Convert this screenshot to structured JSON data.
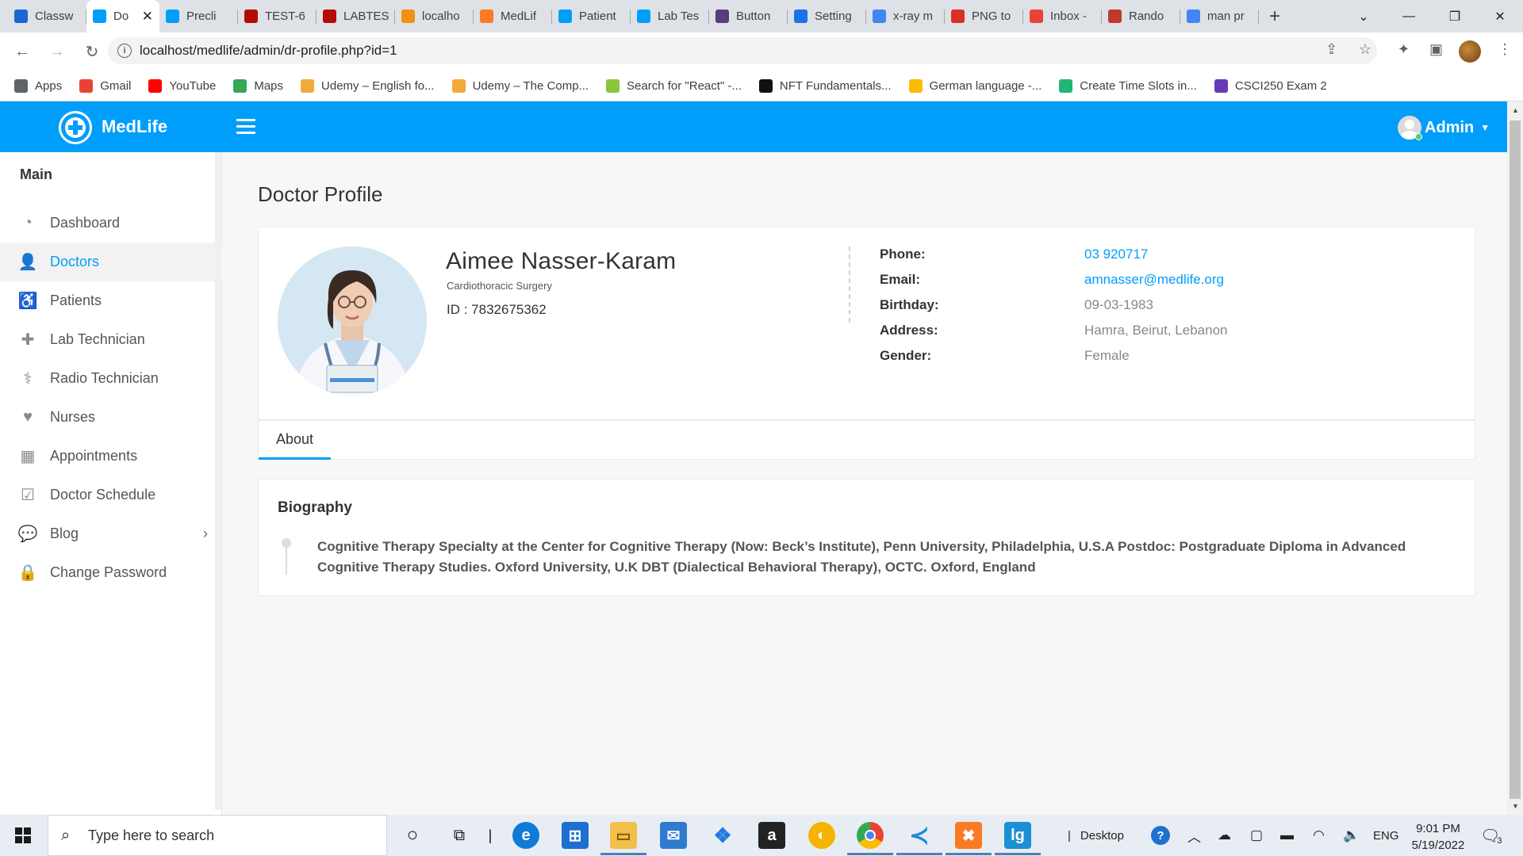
{
  "browser": {
    "tabs": [
      {
        "label": "Classw",
        "icon": "classroom-icon",
        "color": "#1967d2"
      },
      {
        "label": "Do",
        "icon": "medlife-icon",
        "color": "#009efb",
        "active": true
      },
      {
        "label": "Precli",
        "icon": "medlife-icon",
        "color": "#009efb"
      },
      {
        "label": "TEST-6",
        "icon": "pdf-icon",
        "color": "#b30b00"
      },
      {
        "label": "LABTES",
        "icon": "pdf-icon",
        "color": "#b30b00"
      },
      {
        "label": "localho",
        "icon": "phpmyadmin-icon",
        "color": "#f29111"
      },
      {
        "label": "MedLif",
        "icon": "xampp-icon",
        "color": "#fb7a24"
      },
      {
        "label": "Patient",
        "icon": "medlife-icon",
        "color": "#009efb"
      },
      {
        "label": "Lab Tes",
        "icon": "medlife-icon",
        "color": "#009efb"
      },
      {
        "label": "Button",
        "icon": "bootstrap-icon",
        "color": "#563d7c"
      },
      {
        "label": "Setting",
        "icon": "gear-icon",
        "color": "#1a73e8"
      },
      {
        "label": "x-ray m",
        "icon": "google-icon",
        "color": "#4285f4"
      },
      {
        "label": "PNG to",
        "icon": "pdf-icon",
        "color": "#d93025"
      },
      {
        "label": "Inbox -",
        "icon": "gmail-icon",
        "color": "#ea4335"
      },
      {
        "label": "Rando",
        "icon": "s-icon",
        "color": "#c0392b"
      },
      {
        "label": "man pr",
        "icon": "google-icon",
        "color": "#4285f4"
      }
    ],
    "close_glyph": "✕",
    "new_tab_glyph": "+",
    "url": "localhost/medlife/admin/dr-profile.php?id=1",
    "bookmarks": [
      {
        "label": "Apps",
        "icon": "apps-grid-icon",
        "color": "#5f6368"
      },
      {
        "label": "Gmail",
        "icon": "gmail-icon",
        "color": "#ea4335"
      },
      {
        "label": "YouTube",
        "icon": "youtube-icon",
        "color": "#ff0000"
      },
      {
        "label": "Maps",
        "icon": "maps-icon",
        "color": "#34a853"
      },
      {
        "label": "Udemy – English fo...",
        "icon": "udemy-icon",
        "color": "#f4a93c"
      },
      {
        "label": "Udemy – The Comp...",
        "icon": "udemy-icon",
        "color": "#f4a93c"
      },
      {
        "label": "Search for \"React\" -...",
        "icon": "upwork-icon",
        "color": "#8cc53f"
      },
      {
        "label": "NFT Fundamentals...",
        "icon": "nft-icon",
        "color": "#111111"
      },
      {
        "label": "German language -...",
        "icon": "drive-icon",
        "color": "#fbbc04"
      },
      {
        "label": "Create Time Slots in...",
        "icon": "dollar-icon",
        "color": "#22b573"
      },
      {
        "label": "CSCI250 Exam 2",
        "icon": "forms-icon",
        "color": "#673ab7"
      }
    ]
  },
  "app": {
    "brand": "MedLife",
    "user": "Admin",
    "sidebar": {
      "title": "Main",
      "items": [
        {
          "label": "Dashboard",
          "icon": "dashboard-icon",
          "glyph": "◔"
        },
        {
          "label": "Doctors",
          "icon": "doctor-icon",
          "glyph": "👤",
          "active": true
        },
        {
          "label": "Patients",
          "icon": "wheelchair-icon",
          "glyph": "♿"
        },
        {
          "label": "Lab Technician",
          "icon": "medkit-icon",
          "glyph": "✚"
        },
        {
          "label": "Radio Technician",
          "icon": "stethoscope-icon",
          "glyph": "⚕"
        },
        {
          "label": "Nurses",
          "icon": "heartbeat-icon",
          "glyph": "♥"
        },
        {
          "label": "Appointments",
          "icon": "calendar-icon",
          "glyph": "▦"
        },
        {
          "label": "Doctor Schedule",
          "icon": "calendar-check-icon",
          "glyph": "☑"
        },
        {
          "label": "Blog",
          "icon": "comment-icon",
          "glyph": "💬",
          "has_submenu": true
        },
        {
          "label": "Change Password",
          "icon": "lock-icon",
          "glyph": "🔒"
        }
      ]
    },
    "page_title": "Doctor Profile",
    "doctor": {
      "name": "Aimee Nasser-Karam",
      "specialty": "Cardiothoracic Surgery",
      "id_text": "ID : 7832675362",
      "fields": [
        {
          "label": "Phone:",
          "value": "03 920717",
          "link": true
        },
        {
          "label": "Email:",
          "value": "amnasser@medlife.org",
          "link": true
        },
        {
          "label": "Birthday:",
          "value": "09-03-1983",
          "link": false
        },
        {
          "label": "Address:",
          "value": "Hamra, Beirut, Lebanon",
          "link": false
        },
        {
          "label": "Gender:",
          "value": "Female",
          "link": false
        }
      ]
    },
    "tabs": [
      {
        "label": "About",
        "active": true
      }
    ],
    "biography": {
      "title": "Biography",
      "text": "Cognitive Therapy Specialty at the Center for Cognitive Therapy (Now: Beck’s Institute), Penn University, Philadelphia, U.S.A Postdoc: Postgraduate Diploma in Advanced Cognitive Therapy Studies. Oxford University, U.K DBT (Dialectical Behavioral Therapy), OCTC. Oxford, England"
    },
    "accent_color": "#009efb"
  },
  "taskbar": {
    "search_placeholder": "Type here to search",
    "desktop_label": "Desktop",
    "language": "ENG",
    "time": "9:01 PM",
    "date": "5/19/2022",
    "notification_count": "3"
  }
}
